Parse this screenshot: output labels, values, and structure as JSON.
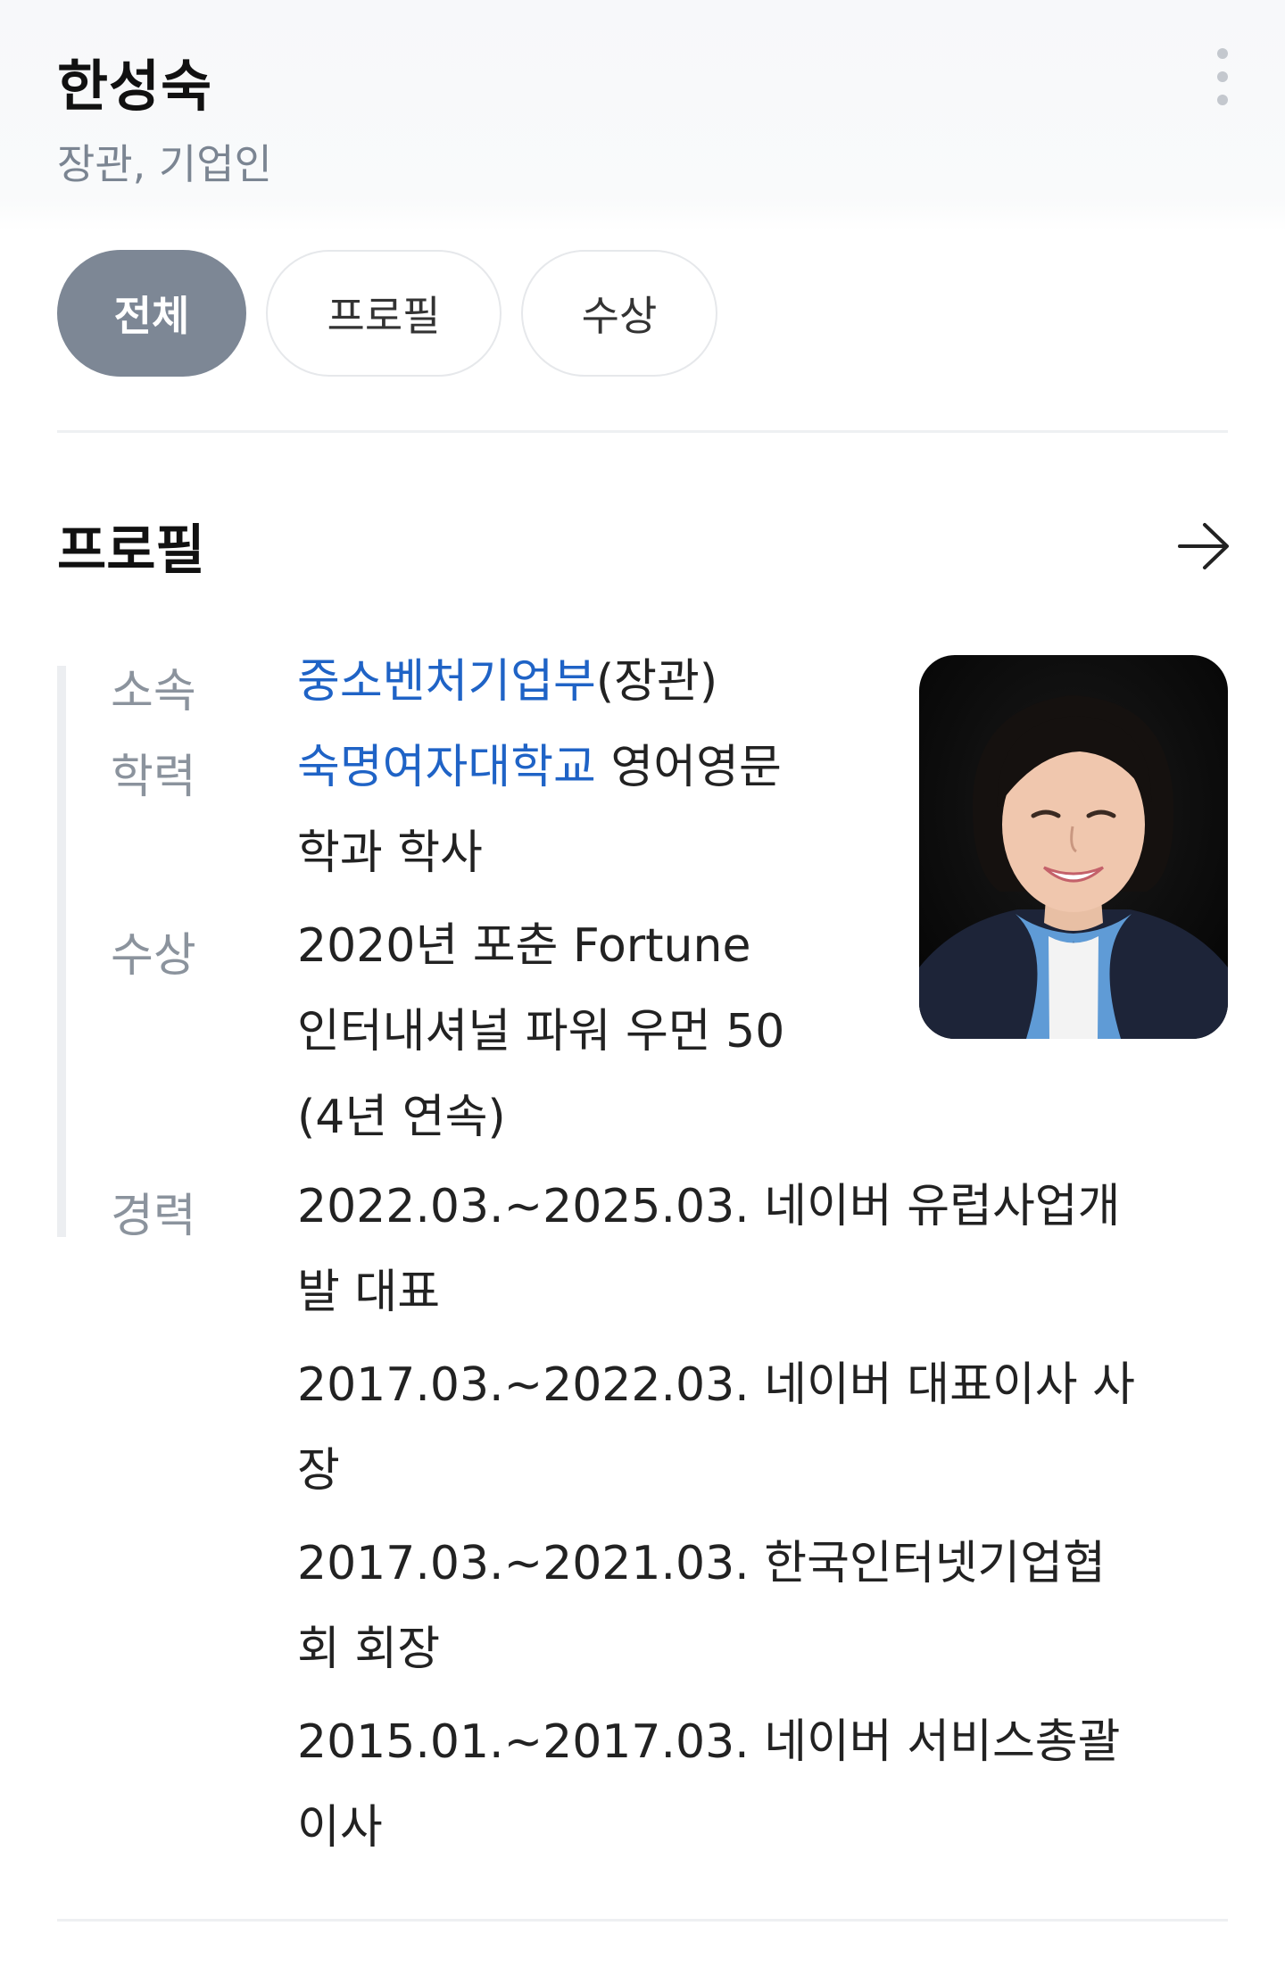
{
  "person": {
    "name": "한성숙",
    "subtitle": "장관, 기업인"
  },
  "tabs": [
    {
      "label": "전체",
      "active": true
    },
    {
      "label": "프로필",
      "active": false
    },
    {
      "label": "수상",
      "active": false
    }
  ],
  "profile": {
    "title": "프로필",
    "affiliation": {
      "label": "소속",
      "link": "중소벤처기업부",
      "suffix": "(장관)"
    },
    "education": {
      "label": "학력",
      "link": "숙명여자대학교",
      "suffix_line1": " 영어영문",
      "line2": "학과 학사"
    },
    "award": {
      "label": "수상",
      "line1": "2020년 포춘 Fortune",
      "line2": "인터내셔널 파워 우먼 50",
      "line3": "(4년 연속)"
    },
    "career": {
      "label": "경력",
      "items": [
        {
          "line1": "2022.03.~2025.03. 네이버 유럽사업개",
          "line2": "발 대표"
        },
        {
          "line1": "2017.03.~2022.03. 네이버 대표이사 사",
          "line2": "장"
        },
        {
          "line1": "2017.03.~2021.03. 한국인터넷기업협",
          "line2": "회 회장"
        },
        {
          "line1": "2015.01.~2017.03. 네이버 서비스총괄",
          "line2": "이사"
        }
      ]
    }
  },
  "colors": {
    "link": "#1f63c6",
    "active_tab": "#7d8795",
    "label_gray": "#8b939d"
  },
  "icons": {
    "more": "more-vertical-icon",
    "arrow": "arrow-right-icon",
    "photo": "profile-photo"
  }
}
